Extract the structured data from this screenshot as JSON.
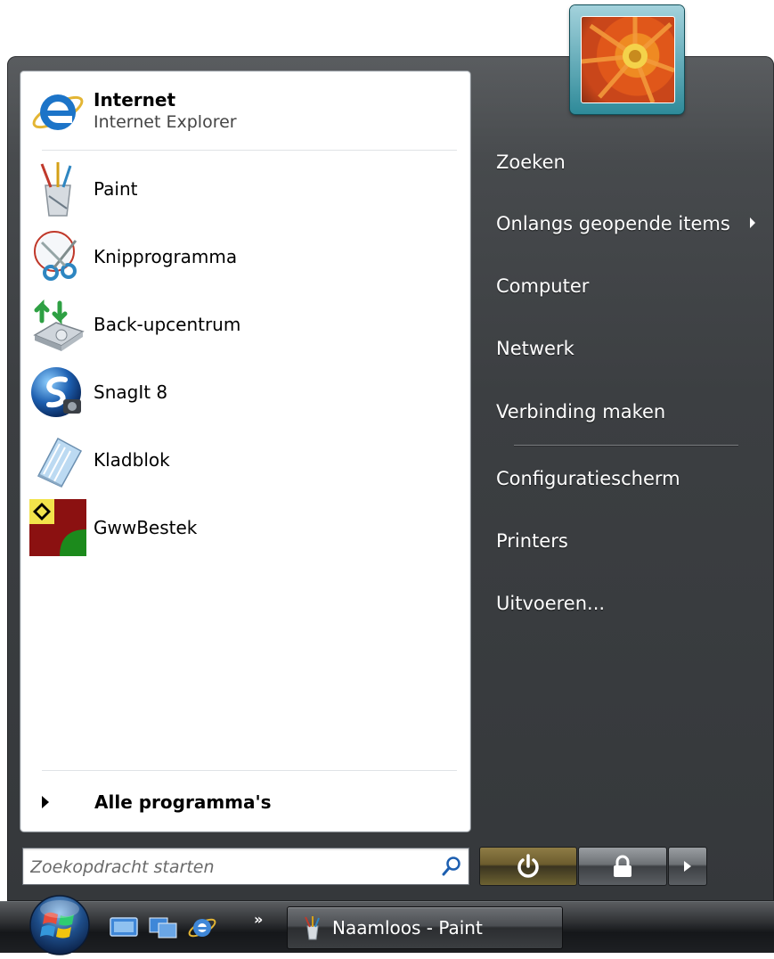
{
  "pinned": {
    "internet": {
      "title": "Internet",
      "subtitle": "Internet Explorer"
    }
  },
  "recent": [
    {
      "label": "Paint"
    },
    {
      "label": "Knipprogramma"
    },
    {
      "label": "Back-upcentrum"
    },
    {
      "label": "SnagIt 8"
    },
    {
      "label": "Kladblok"
    },
    {
      "label": "GwwBestek"
    }
  ],
  "all_programs": {
    "label": "Alle programma's"
  },
  "right_menu": [
    {
      "label": "Zoeken"
    },
    {
      "label": "Onlangs geopende items"
    },
    {
      "label": "Computer"
    },
    {
      "label": "Netwerk"
    },
    {
      "label": "Verbinding maken"
    },
    {
      "label": "Configuratiescherm"
    },
    {
      "label": "Printers"
    },
    {
      "label": "Uitvoeren..."
    }
  ],
  "search": {
    "placeholder": "Zoekopdracht starten"
  },
  "taskbar": {
    "chevron": "»",
    "window_button": {
      "label": "Naamloos - Paint"
    }
  },
  "colors": {
    "menu_dark": "#3c3f42",
    "left_pane": "#ffffff",
    "taskbar": "#1e2023"
  },
  "icons": {
    "internet": "internet-explorer-icon",
    "paint": "paint-icon",
    "snipping": "scissors-icon",
    "backup": "backup-icon",
    "snagit": "snagit-icon",
    "notepad": "notepad-icon",
    "gwwbestek": "gwwbestek-icon"
  }
}
